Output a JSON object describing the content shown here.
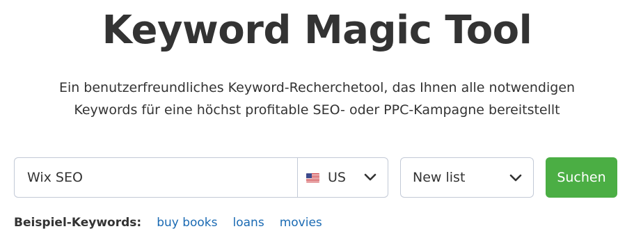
{
  "page": {
    "title": "Keyword Magic Tool",
    "subtitle_line1": "Ein benutzerfreundliches Keyword-Recherchetool, das Ihnen alle notwendigen",
    "subtitle_line2": "Keywords für eine höchst profitable SEO- oder PPC-Kampagne bereitstellt"
  },
  "search": {
    "keyword_value": "Wix SEO",
    "database": {
      "label": "US",
      "flag_icon": "us-flag-icon"
    },
    "list": {
      "label": "New list"
    },
    "button_label": "Suchen"
  },
  "examples": {
    "label": "Beispiel-Keywords:",
    "links": [
      "buy books",
      "loans",
      "movies"
    ]
  },
  "colors": {
    "accent_green": "#4bae44",
    "link_blue": "#1a6ab3",
    "border": "#c2c9d6",
    "text": "#333333"
  }
}
